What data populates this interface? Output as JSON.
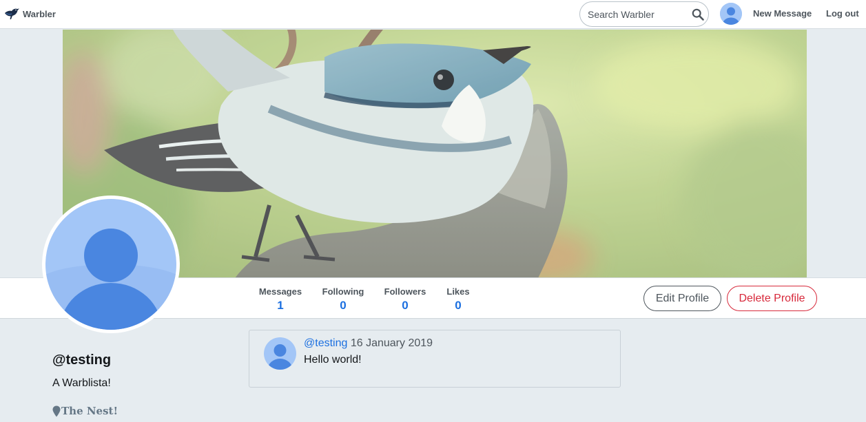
{
  "navbar": {
    "brand": "Warbler",
    "search_placeholder": "Search Warbler",
    "new_message": "New Message",
    "logout": "Log out"
  },
  "stats": {
    "messages_label": "Messages",
    "messages_value": "1",
    "following_label": "Following",
    "following_value": "0",
    "followers_label": "Followers",
    "followers_value": "0",
    "likes_label": "Likes",
    "likes_value": "0"
  },
  "actions": {
    "edit": "Edit Profile",
    "delete": "Delete Profile"
  },
  "profile": {
    "username": "@testing",
    "bio": "A Warblista!",
    "location": "The Nest!"
  },
  "messages": [
    {
      "user": "@testing",
      "date": "16 January 2019",
      "text": "Hello world!"
    }
  ],
  "colors": {
    "accent": "#1b6fe0",
    "danger": "#d7283a",
    "page_bg": "#e6ecf0"
  },
  "icons": {
    "brand": "warbler-bird-logo",
    "search": "magnifier",
    "location": "map-pin",
    "avatar": "default-user-silhouette"
  }
}
